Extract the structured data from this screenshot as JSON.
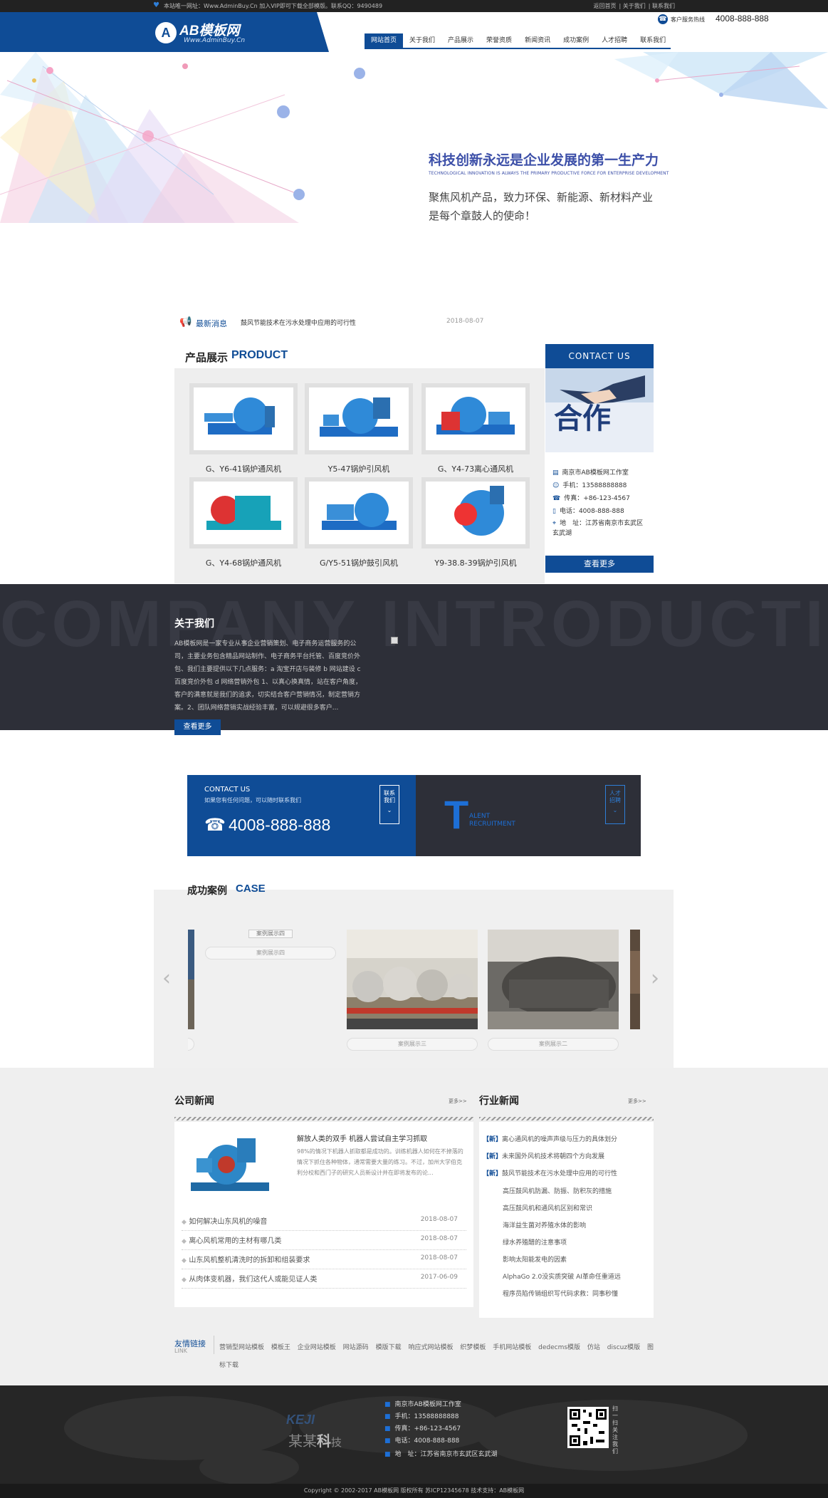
{
  "topbar": {
    "notice": "本站唯一网址：Www.AdminBuy.Cn 加入VIP即可下载全部模版。联系QQ：9490489",
    "links": [
      "返回首页",
      "关于我们",
      "联系我们"
    ]
  },
  "header": {
    "logo_letter": "A",
    "logo_title": "AB模板网",
    "logo_sub": "Www.AdminBuy.Cn",
    "hotline_label": "客户服务热线",
    "hotline_number": "4008-888-888",
    "nav": [
      {
        "label": "网站首页",
        "active": true
      },
      {
        "label": "关于我们"
      },
      {
        "label": "产品展示"
      },
      {
        "label": "荣誉资质"
      },
      {
        "label": "新闻资讯"
      },
      {
        "label": "成功案例"
      },
      {
        "label": "人才招聘"
      },
      {
        "label": "联系我们"
      }
    ]
  },
  "banner": {
    "title": "科技创新永远是企业发展的第一生产力",
    "en": "TECHNOLOGICAL INNOVATION IS ALWAYS THE PRIMARY PRODUCTIVE FORCE FOR ENTERPRISE DEVELOPMENT",
    "sub1": "聚焦风机产品，致力环保、新能源、新材料产业",
    "sub2": "是每个章鼓人的使命！"
  },
  "ticker": {
    "label": "最新消息",
    "text": "鼓风节能技术在污水处理中应用的可行性",
    "date": "2018-08-07"
  },
  "products": {
    "title": "产品展示",
    "title_en": "PRODUCT",
    "items": [
      {
        "name": "G、Y6-41锅炉通风机"
      },
      {
        "name": "Y5-47锅炉引风机"
      },
      {
        "name": "G、Y4-73离心通风机"
      },
      {
        "name": "G、Y4-68锅炉通风机"
      },
      {
        "name": "G/Y5-51锅炉鼓引风机"
      },
      {
        "name": "Y9-38.8-39锅炉引风机"
      }
    ]
  },
  "contact_card": {
    "head": "CONTACT US",
    "img_text": "合作",
    "company": "南京市AB模板网工作室",
    "mobile": "手机：13588888888",
    "fax": "传真：+86-123-4567",
    "phone": "电话：4008-888-888",
    "address": "地　址：江苏省南京市玄武区玄武湖",
    "more": "查看更多"
  },
  "intro": {
    "bg_text": "COMPANY INTRODUCTION",
    "title": "关于我们",
    "text": "AB模板网是一家专业从事企业营销策划、电子商务运营服务的公司，主要业务包含精品网站制作、电子商务平台托管、百度竞价外包、我们主要提供以下几点服务：a 淘宝开店与装修 b 网站建设 c 百度竞价外包 d 网络营销外包 1、以真心换真情，站在客户角度，客户的满意就是我们的追求，切实结合客户营销情况，制定营销方案。2、团队网络营销实战经验丰富，可以规避很多客户...",
    "more": "查看更多"
  },
  "cta": {
    "en": "CONTACT US",
    "small": "如果您有任何问题，可以随时联系我们",
    "phone": "4008-888-888",
    "box_left": "联系我们",
    "talent_letter": "T",
    "talent_line1": "ALENT",
    "talent_line2": "RECRUITMENT",
    "box_right": "人才招聘"
  },
  "cases": {
    "title": "成功案例",
    "title_en": "CASE",
    "items": [
      {
        "caption": "案例展示四",
        "alt": "案例展示四"
      },
      {
        "caption": "案例展示三"
      },
      {
        "caption": "案例展示二"
      }
    ]
  },
  "company_news": {
    "title": "公司新闻",
    "more": "更多>>",
    "feature_title": "解放人类的双手 机器人尝试自主学习抓取",
    "feature_text": "98%的情况下机器人抓取都是成功的。训练机器人如何在不掉落的情况下抓住各种物体，通常需要大量的练习。不过，加州大学伯克利分校和西门子的研究人员新设计并在即将发布的论...",
    "items": [
      {
        "title": "如何解决山东风机的噪音",
        "date": "2018-08-07"
      },
      {
        "title": "离心风机常用的主材有哪几类",
        "date": "2018-08-07"
      },
      {
        "title": "山东风机整机清洗时的拆卸和组装要求",
        "date": "2018-08-07"
      },
      {
        "title": "从肉体变机器，我们这代人或能见证人类",
        "date": "2017-06-09"
      }
    ]
  },
  "industry_news": {
    "title": "行业新闻",
    "more": "更多>>",
    "tag": "【新】",
    "new_items": [
      "离心通风机的噪声声级与压力的具体划分",
      "未来国外风机技术将朝四个方向发展",
      "鼓风节能技术在污水处理中应用的可行性"
    ],
    "items": [
      "高压鼓风机防漏、防振、防积灰的措施",
      "高压鼓风机和通风机区别和常识",
      "海洋益生菌对养殖水体的影响",
      "绿水养殖醋的注意事项",
      "影响太阳能发电的因素",
      "AlphaGo 2.0没实质突破 AI革命任重道远",
      "程序员陷传销组织写代码求救：同事秒懂"
    ]
  },
  "friend_links": {
    "title": "友情链接",
    "title_en": "LINK",
    "items": [
      "营销型网站模板",
      "模板王",
      "企业网站模板",
      "网站源码",
      "模版下载",
      "响应式网站模板",
      "织梦模板",
      "手机网站模板",
      "dedecms模版",
      "仿站",
      "discuz模版",
      "图标下载"
    ]
  },
  "footer": {
    "keji": "KEJI",
    "brand_a": "某某",
    "brand_b": "科",
    "brand_c": "技",
    "rows": [
      "南京市AB模板网工作室",
      "手机：13588888888",
      "传真：+86-123-4567",
      "电话：4008-888-888",
      "地　址：江苏省南京市玄武区玄武湖"
    ],
    "qr_text": "扫一扫关注我们",
    "copyright": "Copyright © 2002-2017 AB模板网 版权所有  苏ICP12345678  技术支持：AB模板网"
  }
}
